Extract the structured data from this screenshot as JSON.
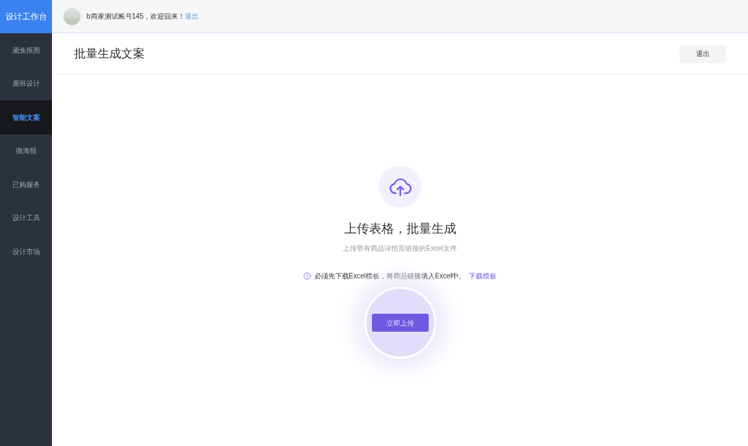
{
  "brand": "设计工作台",
  "sidebar": {
    "items": [
      {
        "label": "顽兔抠图",
        "selected": false
      },
      {
        "label": "鹿班设计",
        "selected": false
      },
      {
        "label": "智能文案",
        "selected": true
      },
      {
        "label": "微海报",
        "selected": false
      },
      {
        "label": "已购服务",
        "selected": false
      },
      {
        "label": "设计工具",
        "selected": false
      },
      {
        "label": "设计市场",
        "selected": false
      }
    ]
  },
  "topbar": {
    "welcome": "b商家测试帐号145，欢迎回来！",
    "logout_link": "退出"
  },
  "page": {
    "title": "批量生成文案",
    "exit_button": "退出"
  },
  "upload": {
    "heading": "上传表格，批量生成",
    "subtitle": "上传带有商品详情页链接的Excel文件",
    "notice": "必须先下载Excel模板，将商品链接填入Excel中。",
    "template_link": "下载模板",
    "upload_button": "立即上传"
  }
}
